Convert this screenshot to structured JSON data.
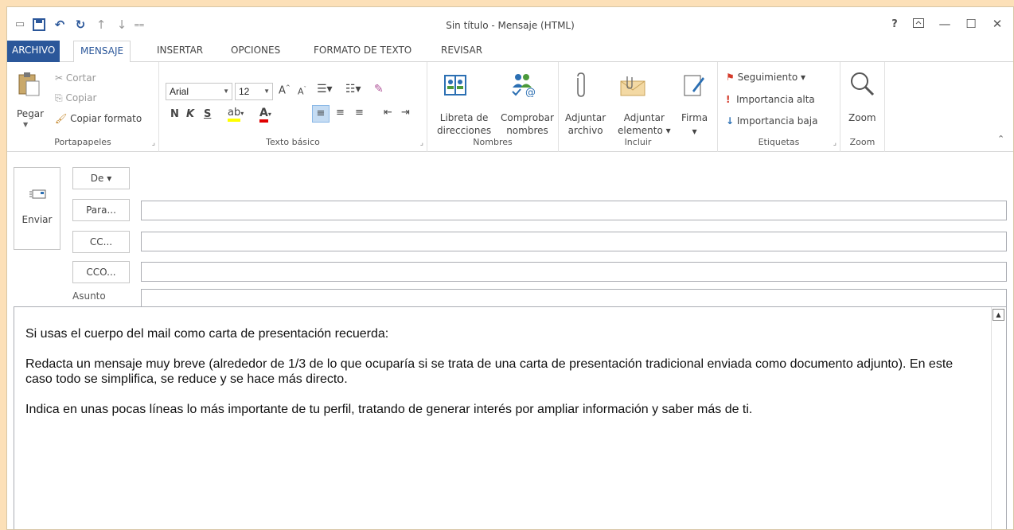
{
  "window": {
    "title": "Sin título - Mensaje (HTML)"
  },
  "quick_access": [
    "save-icon",
    "undo-icon",
    "redo-icon",
    "up-icon",
    "down-icon"
  ],
  "window_controls": {
    "help": "?",
    "ribbon_display": "⊼",
    "minimize": "—",
    "maximize": "☐",
    "close": "✕"
  },
  "tabs": [
    {
      "label": "ARCHIVO"
    },
    {
      "label": "MENSAJE"
    },
    {
      "label": "INSERTAR"
    },
    {
      "label": "OPCIONES"
    },
    {
      "label": "FORMATO DE TEXTO"
    },
    {
      "label": "REVISAR"
    }
  ],
  "ribbon": {
    "clipboard": {
      "label": "Portapapeles",
      "paste": "Pegar",
      "cut": "Cortar",
      "copy": "Copiar",
      "format_painter": "Copiar formato"
    },
    "basic_text": {
      "label": "Texto básico",
      "font": "Arial",
      "size": "12",
      "bold": "N",
      "italic": "K",
      "underline": "S"
    },
    "names": {
      "label": "Nombres",
      "address_book_1": "Libreta de",
      "address_book_2": "direcciones",
      "check_names_1": "Comprobar",
      "check_names_2": "nombres"
    },
    "include": {
      "label": "Incluir",
      "attach_file_1": "Adjuntar",
      "attach_file_2": "archivo",
      "attach_item_1": "Adjuntar",
      "attach_item_2": "elemento ▾",
      "signature": "Firma"
    },
    "tags": {
      "label": "Etiquetas",
      "follow_up": "Seguimiento ▾",
      "high_importance": "Importancia alta",
      "low_importance": "Importancia baja"
    },
    "zoom": {
      "label": "Zoom",
      "button": "Zoom"
    }
  },
  "compose": {
    "send": "Enviar",
    "from": "De ▾",
    "to": "Para...",
    "cc": "CC...",
    "bcc": "CCO...",
    "subject_label": "Asunto",
    "to_value": "",
    "cc_value": "",
    "bcc_value": "",
    "subject_value": ""
  },
  "body": {
    "p1": "Si usas el cuerpo del mail como carta de presentación recuerda:",
    "p2": "Redacta un mensaje muy breve (alrededor de 1/3 de lo que ocuparía si se trata de una carta de presentación tradicional enviada como documento adjunto). En este caso todo se simplifica, se reduce y se hace más directo.",
    "p3": "Indica en unas pocas líneas lo más importante de tu perfil, tratando de generar interés por ampliar información y saber más de ti."
  },
  "colors": {
    "accent": "#2b579a",
    "frame": "#fce0b8",
    "highlight": "#ffff00",
    "font_color": "#e00000"
  }
}
